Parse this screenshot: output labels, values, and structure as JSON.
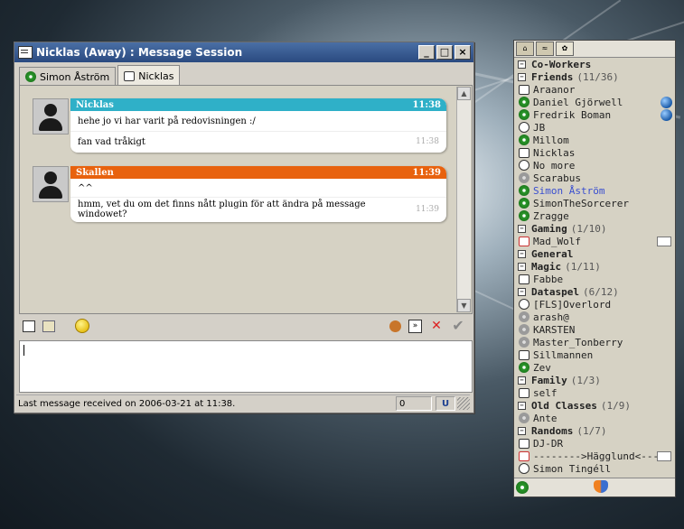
{
  "chat": {
    "title": "Nicklas (Away) : Message Session",
    "tabs": [
      {
        "label": "Simon Åström"
      },
      {
        "label": "Nicklas"
      }
    ],
    "messages": [
      {
        "sender": "Nicklas",
        "time": "11:38",
        "header_color": "#2fb0c8",
        "lines": [
          {
            "text": "hehe jo vi har varit på redovisningen :/",
            "time": ""
          },
          {
            "text": "fan vad tråkigt",
            "time": "11:38"
          }
        ]
      },
      {
        "sender": "Skallen",
        "time": "11:39",
        "header_color": "#e8620e",
        "lines": [
          {
            "text": "^^",
            "time": ""
          },
          {
            "text": "hmm, vet du om det finns nått plugin för att ändra på message windowet?",
            "time": "11:39"
          }
        ]
      }
    ],
    "status_text": "Last message received on 2006-03-21 at 11:38.",
    "char_count": "0",
    "underline_label": "U"
  },
  "contacts": {
    "groups_colors": {
      "selected": "#3a4fd0"
    },
    "rows": [
      {
        "type": "group",
        "label": "Co-Workers",
        "count": ""
      },
      {
        "type": "group",
        "label": "Friends",
        "count": "(11/36)"
      },
      {
        "type": "contact",
        "name": "Araanor",
        "status": "mobile"
      },
      {
        "type": "contact",
        "name": "Daniel Gjörwell",
        "status": "online",
        "extra": "globe"
      },
      {
        "type": "contact",
        "name": "Fredrik Boman",
        "status": "online",
        "extra": "globe"
      },
      {
        "type": "contact",
        "name": "JB",
        "status": "clock"
      },
      {
        "type": "contact",
        "name": "Millom",
        "status": "online"
      },
      {
        "type": "contact",
        "name": "Nicklas",
        "status": "mobile"
      },
      {
        "type": "contact",
        "name": "No more",
        "status": "clock"
      },
      {
        "type": "contact",
        "name": "Scarabus",
        "status": "gray"
      },
      {
        "type": "contact",
        "name": "Simon Åström",
        "status": "online",
        "selected": true
      },
      {
        "type": "contact",
        "name": "SimonTheSorcerer",
        "status": "online"
      },
      {
        "type": "contact",
        "name": "Zragge",
        "status": "online"
      },
      {
        "type": "group",
        "label": "Gaming",
        "count": "(1/10)"
      },
      {
        "type": "contact",
        "name": "Mad_Wolf",
        "status": "away",
        "extra": "mail"
      },
      {
        "type": "group",
        "label": "General",
        "count": ""
      },
      {
        "type": "group",
        "label": "Magic",
        "count": "(1/11)"
      },
      {
        "type": "contact",
        "name": "Fabbe",
        "status": "mobile"
      },
      {
        "type": "group",
        "label": "Dataspel",
        "count": "(6/12)"
      },
      {
        "type": "contact",
        "name": "[FLS]Overlord",
        "status": "clock"
      },
      {
        "type": "contact",
        "name": "arash@",
        "status": "gray"
      },
      {
        "type": "contact",
        "name": "KARSTEN",
        "status": "gray"
      },
      {
        "type": "contact",
        "name": "Master_Tonberry",
        "status": "gray"
      },
      {
        "type": "contact",
        "name": "Sillmannen",
        "status": "mobile"
      },
      {
        "type": "contact",
        "name": "Zev",
        "status": "online"
      },
      {
        "type": "group",
        "label": "Family",
        "count": "(1/3)"
      },
      {
        "type": "contact",
        "name": "self",
        "status": "mobile"
      },
      {
        "type": "group",
        "label": "Old Classes",
        "count": "(1/9)"
      },
      {
        "type": "contact",
        "name": "Ante",
        "status": "gray"
      },
      {
        "type": "group",
        "label": "Randoms",
        "count": "(1/7)"
      },
      {
        "type": "contact",
        "name": "DJ-DR",
        "status": "mobile"
      },
      {
        "type": "contact",
        "name": "-------->Hägglund<-----",
        "status": "away",
        "extra": "mail"
      },
      {
        "type": "contact",
        "name": "Simon Tingéll",
        "status": "clock"
      }
    ]
  }
}
